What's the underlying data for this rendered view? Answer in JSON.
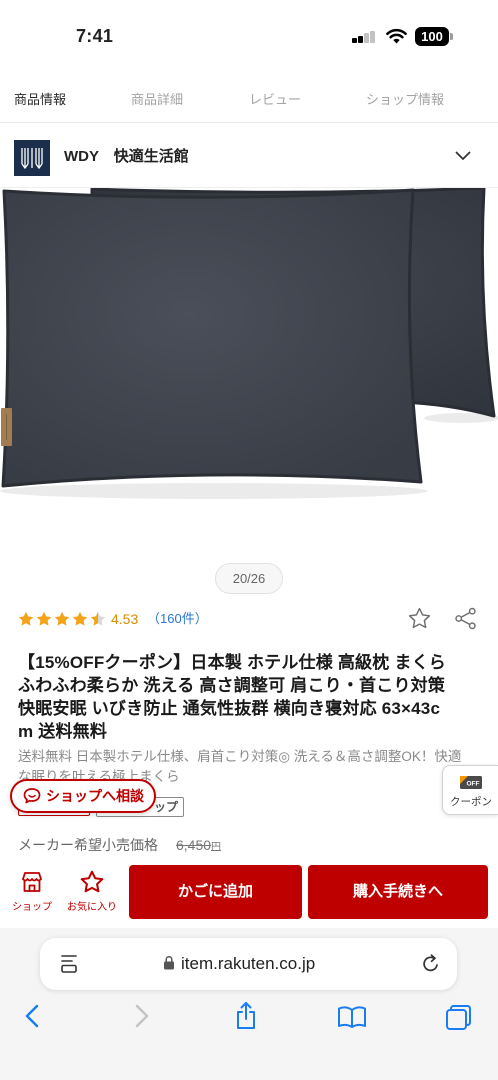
{
  "status_bar": {
    "time": "7:41",
    "battery": "100",
    "signal_bars_active": 2
  },
  "tabs": [
    {
      "label": "商品情報",
      "active": true
    },
    {
      "label": "商品詳細",
      "active": false
    },
    {
      "label": "レビュー",
      "active": false
    },
    {
      "label": "ショップ情報",
      "active": false
    }
  ],
  "shop": {
    "logo_text": "WDY",
    "name": "WDY　快適生活館"
  },
  "gallery": {
    "counter": "20/26"
  },
  "rating": {
    "stars_filled": 4.5,
    "score": "4.53",
    "count": "（160件）"
  },
  "title_lines": [
    "【15%OFFクーポン】日本製 ホテル仕様 高級枕 まくら",
    "ふわふわ柔らか 洗える 高さ調整可 肩こり・首こり対策",
    "快眠安眠 いびき防止 通気性抜群 横向き寝対応 63×43c",
    "m 送料無料"
  ],
  "description_lines": [
    "送料無料 日本製ホテル仕様、肩首こり対策◎ 洗える＆高さ調整OK！快適",
    "な眠りを叶える極上まくら"
  ],
  "tags": {
    "partial_tag_text": "ップ"
  },
  "consult_button": {
    "label": "ショップへ相談"
  },
  "coupon_button": {
    "icon_text": "OFF",
    "label": "クーポン"
  },
  "price": {
    "label": "メーカー希望小売価格",
    "value": "6,450",
    "unit": "円"
  },
  "action_bar": {
    "shop_label": "ショップ",
    "favorite_label": "お気に入り",
    "add_to_cart": "かごに追加",
    "checkout": "購入手続きへ"
  },
  "browser": {
    "url": "item.rakuten.co.jp"
  },
  "icons": {
    "status": [
      "signal-icon",
      "wifi-icon",
      "battery-icon"
    ],
    "shop_row": [
      "shop-logo",
      "chevron-down-icon"
    ],
    "rating_row": [
      "star-outline-icon",
      "share-icon"
    ],
    "action_bar": [
      "store-icon",
      "star-outline-icon"
    ],
    "browser": [
      "page-menu-icon",
      "lock-icon",
      "reload-icon",
      "back-icon",
      "forward-icon",
      "share-icon",
      "bookmarks-icon",
      "tabs-icon"
    ]
  },
  "colors": {
    "brand_red": "#bf0000",
    "star": "#f3a41b",
    "score": "#d98a00",
    "link_blue": "#2a77d6",
    "ios_blue": "#1a7cf3",
    "product": "#41464f"
  }
}
